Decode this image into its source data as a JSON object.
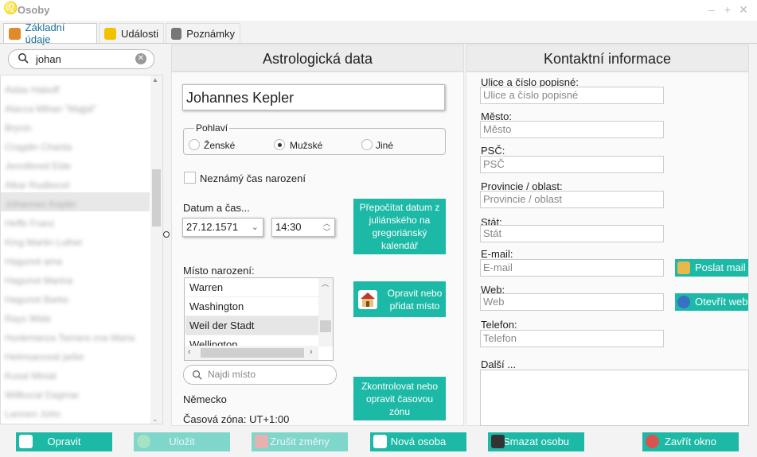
{
  "window": {
    "title": "Osoby"
  },
  "tabs": [
    {
      "label": "Základní údaje",
      "icon": "person-icon"
    },
    {
      "label": "Události",
      "icon": "walker-icon"
    },
    {
      "label": "Poznámky",
      "icon": "notes-icon"
    }
  ],
  "search": {
    "value": "johan"
  },
  "person_list": {
    "items": [
      "Aidas Haboff",
      "Alacca Mihan \"Majjal\"",
      "Brycin",
      "Cragdin Chanta",
      "Jennifered Elde",
      "Alkar Rudbocel",
      "Johannes Kepler",
      "Heffe Franz",
      "King Martin Luther",
      "Hagunot ama",
      "Hagunot Marina",
      "Hagunot Barke",
      "Rays Wide",
      "Hunkmanza Tamara cna Maria",
      "Helmsanceal jarbe",
      "Kusal Minial",
      "Willkocal Dagmar",
      "Larmen John"
    ],
    "selected_index": 6
  },
  "astro": {
    "header": "Astrologická data",
    "name": "Johannes Kepler",
    "gender_label": "Pohlaví",
    "gender_options": [
      "Ženské",
      "Mužské",
      "Jiné"
    ],
    "gender_selected": "Mužské",
    "unknown_time_label": "Neznámý čas narození",
    "datetime_label": "Datum a čas...",
    "date": "27.12.1571",
    "time": "14:30",
    "recalc_button": "Přepočítat datum z juliánského na gregoriánský kalendář",
    "place_label": "Místo narození:",
    "places": [
      "Warren",
      "Washington",
      "Weil der Stadt",
      "Wellington"
    ],
    "place_selected": "Weil der Stadt",
    "fix_place_button": "Opravit nebo přidat místo",
    "find_place_placeholder": "Najdi místo",
    "country": "Německo",
    "timezone": "Časová zóna: UT+1:00",
    "tz_button": "Zkontrolovat nebo opravit časovou zónu"
  },
  "contact": {
    "header": "Kontaktní informace",
    "street_label": "Ulice a číslo popisné:",
    "street_placeholder": "Ulice a číslo popisné",
    "city_label": "Město:",
    "city_placeholder": "Město",
    "zip_label": "PSČ:",
    "zip_placeholder": "PSČ",
    "province_label": "Provincie / oblast:",
    "province_placeholder": "Provincie / oblast",
    "state_label": "Stát:",
    "state_placeholder": "Stát",
    "email_label": "E-mail:",
    "email_placeholder": "E-mail",
    "send_mail_button": "Poslat mail",
    "web_label": "Web:",
    "web_placeholder": "Web",
    "open_web_button": "Otevřít web",
    "phone_label": "Telefon:",
    "phone_placeholder": "Telefon",
    "other_label": "Další ..."
  },
  "toolbar": {
    "edit": "Opravit",
    "save": "Uložit",
    "cancel": "Zrušit změny",
    "new_person": "Nová osoba",
    "delete_person": "Smazat osobu",
    "close_window": "Zavřít okno"
  },
  "colors": {
    "accent": "#1cb9a6",
    "accent_disabled": "#7fd6cb",
    "tab_active_text": "#1a6f9a"
  }
}
